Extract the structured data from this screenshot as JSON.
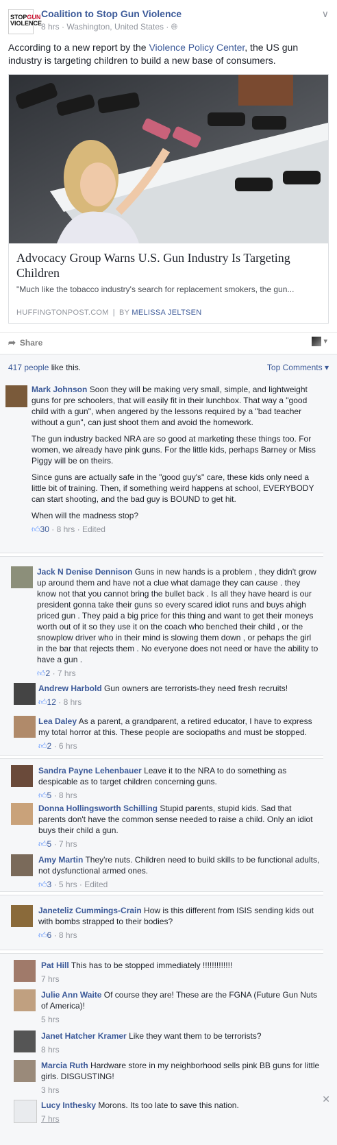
{
  "post": {
    "page_name": "Coalition to Stop Gun Violence",
    "logo_lines": [
      "STOP",
      "GUN",
      "VIOLENCE"
    ],
    "time": "8 hrs",
    "location": "Washington, United States",
    "text_before": "According to a new report by the ",
    "text_link": "Violence Policy Center",
    "text_after": ", the US gun industry is targeting children to build a new base of consumers.",
    "link_title": "Advocacy Group Warns U.S. Gun Industry Is Targeting Children",
    "link_desc": "\"Much like the tobacco industry's search for replacement smokers, the gun...",
    "link_source": "HUFFINGTONPOST.COM",
    "link_by": "BY",
    "link_author": "MELISSA JELTSEN"
  },
  "actions": {
    "share": "Share"
  },
  "feedback": {
    "likes_count": "417 people",
    "likes_rest": " like this.",
    "top_comments": "Top Comments"
  },
  "comments": [
    {
      "name": "Mark Johnson",
      "paras": [
        "Soon they will be making very small, simple, and lightweight guns for pre schoolers, that will easily fit in their lunchbox. That way a \"good child with a gun\", when angered by the lessons required by a \"bad teacher without a gun\", can just shoot them and avoid the homework.",
        "The gun industry backed NRA are so good at marketing these things too. For women, we already have pink guns. For the little kids, perhaps Barney or Miss Piggy will be on theirs.",
        "Since guns are actually safe in the \"good guy's\" care, these kids only need a little bit of training. Then, if something weird happens at school, EVERYBODY can start shooting, and the bad guy is BOUND to get hit.",
        "When will the madness stop?"
      ],
      "likes": "30",
      "time": "8 hrs",
      "extra": "Edited",
      "color": "#7a5a3a"
    },
    {
      "name": "Jack N Denise Dennison",
      "paras": [
        "Guns in new hands is a problem , they didn't grow up around them and have not a clue what damage they can cause . they know not that you cannot bring the bullet back . Is all they have heard is our president gonna take their guns so every scared idiot runs and buys ahigh priced gun . They paid a big price for this thing and want to get their moneys worth out of it so they use it on the coach who benched their child , or the snowplow driver who in their mind is slowing them down , or pehaps the girl in the bar that rejects them . No everyone does not need or have the ability to have a gun ."
      ],
      "likes": "2",
      "time": "7 hrs",
      "extra": "",
      "color": "#8c8f7a"
    },
    {
      "name": "Andrew Harbold",
      "paras": [
        "Gun owners are terrorists-they need fresh recruits!"
      ],
      "likes": "12",
      "time": "8 hrs",
      "extra": "",
      "color": "#444"
    },
    {
      "name": "Lea Daley",
      "paras": [
        "As a parent, a grandparent, a retired educator, I have to express my total horror at this. These people are sociopaths and must be stopped."
      ],
      "likes": "2",
      "time": "6 hrs",
      "extra": "",
      "color": "#b08a6a"
    },
    {
      "name": "Sandra Payne Lehenbauer",
      "paras": [
        "Leave it to the NRA to do something as despicable as to target children concerning guns."
      ],
      "likes": "5",
      "time": "8 hrs",
      "extra": "",
      "color": "#6a4a3a"
    },
    {
      "name": "Donna Hollingsworth Schilling",
      "paras": [
        "Stupid parents, stupid kids. Sad that parents don't have the common sense needed to raise a child. Only an idiot buys their child a gun."
      ],
      "likes": "5",
      "time": "7 hrs",
      "extra": "",
      "color": "#c9a27a"
    },
    {
      "name": "Amy Martin",
      "paras": [
        "They're nuts. Children need to build skills to be functional adults, not dysfunctional armed ones."
      ],
      "likes": "3",
      "time": "5 hrs",
      "extra": "Edited",
      "color": "#7a6a5a"
    },
    {
      "name": "Janeteliz Cummings-Crain",
      "paras": [
        "How is this different from ISIS sending kids out with bombs strapped to their bodies?"
      ],
      "likes": "6",
      "time": "8 hrs",
      "extra": "",
      "color": "#8a6a3a"
    },
    {
      "name": "Pat Hill",
      "paras": [
        "This has to be stopped immediately !!!!!!!!!!!!!"
      ],
      "likes": "",
      "time": "7 hrs",
      "extra": "",
      "color": "#a07a6a"
    },
    {
      "name": "Julie Ann Waite",
      "paras": [
        "Of course they are! These are the FGNA (Future Gun Nuts of America)!"
      ],
      "likes": "",
      "time": "5 hrs",
      "extra": "",
      "color": "#c0a080"
    },
    {
      "name": "Janet Hatcher Kramer",
      "paras": [
        "Like they want them to be terrorists?"
      ],
      "likes": "",
      "time": "8 hrs",
      "extra": "",
      "color": "#555"
    },
    {
      "name": "Marcia Ruth",
      "paras": [
        "Hardware store in my neighborhood sells pink BB guns for little girls. DISGUSTING!"
      ],
      "likes": "",
      "time": "3 hrs",
      "extra": "",
      "color": "#9a8a7a"
    },
    {
      "name": "Lucy Inthesky",
      "paras": [
        "Morons. Its too late to save this nation."
      ],
      "likes": "",
      "time": "7 hrs",
      "extra": "",
      "color": "#e9ebee"
    }
  ],
  "stray_times": [
    "6 hrs",
    "Edited",
    "8 hrs"
  ]
}
